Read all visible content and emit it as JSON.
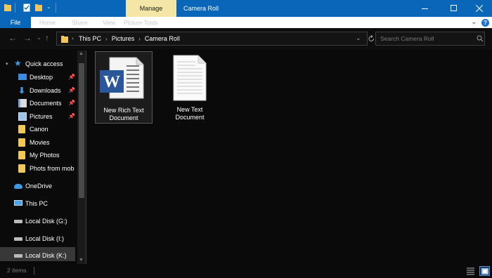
{
  "titlebar": {
    "manage_tab": "Manage",
    "title": "Camera Roll",
    "accent": "#0a66b8",
    "manage_bg": "#f3e6a6"
  },
  "ribbon": {
    "file": "File",
    "tabs": [
      "Home",
      "Share",
      "View",
      "Picture Tools"
    ]
  },
  "address": {
    "breadcrumbs": [
      "This PC",
      "Pictures",
      "Camera Roll"
    ],
    "search_placeholder": "Search Camera Roll"
  },
  "sidebar": {
    "quick_access": "Quick access",
    "quick_items": [
      {
        "label": "Desktop",
        "icon": "desktop-icon",
        "pinned": true
      },
      {
        "label": "Downloads",
        "icon": "download-icon",
        "pinned": true
      },
      {
        "label": "Documents",
        "icon": "documents-icon",
        "pinned": true
      },
      {
        "label": "Pictures",
        "icon": "pictures-icon",
        "pinned": true
      },
      {
        "label": "Canon",
        "icon": "folder-icon",
        "pinned": false
      },
      {
        "label": "Movies",
        "icon": "folder-icon",
        "pinned": false
      },
      {
        "label": "My Photos",
        "icon": "folder-icon",
        "pinned": false
      },
      {
        "label": "Phots from mob",
        "icon": "folder-icon",
        "pinned": false
      }
    ],
    "onedrive": "OneDrive",
    "this_pc": "This PC",
    "disks": [
      "Local Disk (G:)",
      "Local Disk (I:)",
      "Local Disk (K:)"
    ]
  },
  "files": [
    {
      "line1": "New Rich Text",
      "line2": "Document",
      "icon": "word-document-icon"
    },
    {
      "line1": "New Text",
      "line2": "Document",
      "icon": "text-document-icon"
    }
  ],
  "status": {
    "count": "2 items"
  }
}
